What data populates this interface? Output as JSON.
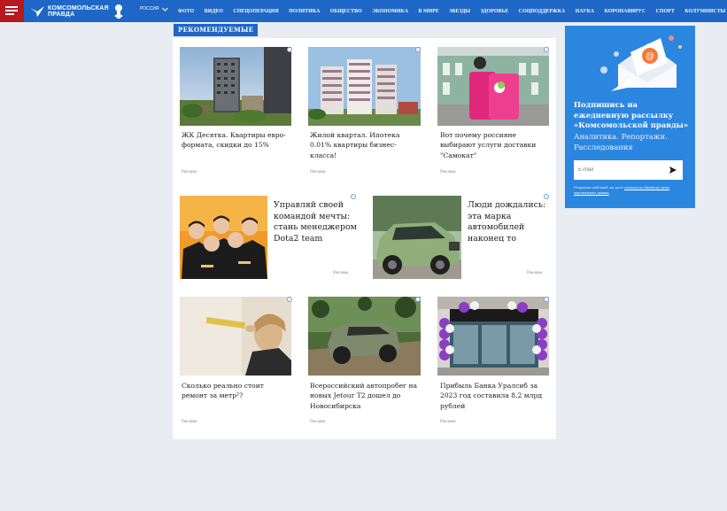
{
  "header": {
    "menu_icon": "hamburger-icon",
    "logo_line1": "КОМСОМОЛЬСКАЯ",
    "logo_line2": "ПРАВДА",
    "region": "РОССИЯ",
    "nav": [
      "ФОТО",
      "ВИДЕО",
      "СПЕЦОПЕРАЦИЯ",
      "ПОЛИТИКА",
      "ОБЩЕСТВО",
      "ЭКОНОМИКА",
      "В МИРЕ",
      "ЗВЕЗДЫ",
      "ЗДОРОВЬЕ",
      "СОЦПОДДЕРЖКА",
      "НАУКА",
      "КОРОНАВИРУС",
      "СПОРТ",
      "КОЛУМНИСТЫ"
    ]
  },
  "section": {
    "tag": "РЕКОМЕНДУЕМЫЕ"
  },
  "cards": [
    {
      "title": "ЖК Десятка. Квартиры евро-формата, скидки до 15%",
      "ad": "Реклама"
    },
    {
      "title": "Жилой квартал. Ипотека 0.01% квартиры бизнес-класса!",
      "ad": "Реклама"
    },
    {
      "title": "Вот почему россияне выбирают услуги доставки \"Самокат\"",
      "ad": "Реклама"
    },
    {
      "title": "Управляй своей командой мечты: стань менеджером Dota2 team",
      "ad": "Реклама"
    },
    {
      "title": "Люди дождались: эта марка автомобилей наконец то",
      "ad": "Реклама"
    },
    {
      "title": "Сколько реально стоит ремонт за метр²?",
      "ad": "Реклама"
    },
    {
      "title": "Всероссийский автопробег на новых Jetour T2 дошел до Новосибирска",
      "ad": "Реклама"
    },
    {
      "title": "Прибыль Банка Уралсиб за 2023 год составила 8,2 млрд рублей",
      "ad": "Реклама"
    }
  ],
  "subscribe": {
    "title": "Подпишись на ежедневную рассылку «Комсомольской правды»",
    "subtitle": "Аналитика. Репортажи. Расследования",
    "email_placeholder": "E-mail",
    "fine_print": "Отправляя свой email, вы даете",
    "fine_link": "согласие на обработку своих персональных данных",
    "send_icon": "send-arrow-icon"
  },
  "colors": {
    "brand_blue": "#1e67c6",
    "menu_red": "#b8191e",
    "subscribe_blue": "#2b86e0"
  }
}
